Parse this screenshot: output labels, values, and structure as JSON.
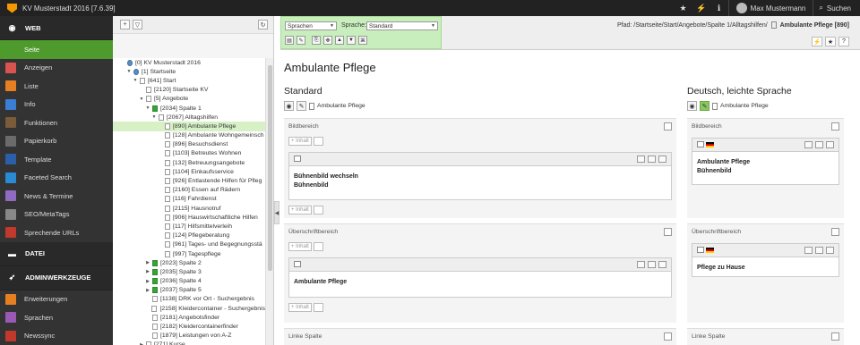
{
  "topbar": {
    "site_name": "KV Musterstadt 2016 [7.6.39]",
    "user_name": "Max Mustermann",
    "search_label": "Suchen"
  },
  "module_menu": {
    "groups": [
      {
        "label": "WEB",
        "icon": "globe-icon",
        "items": [
          {
            "label": "Seite",
            "icon": "page-module-icon",
            "color": "#4f9a2d",
            "active": true
          },
          {
            "label": "Anzeigen",
            "icon": "view-module-icon",
            "color": "#d9534f"
          },
          {
            "label": "Liste",
            "icon": "list-module-icon",
            "color": "#e67e22"
          },
          {
            "label": "Info",
            "icon": "info-module-icon",
            "color": "#3a7fd5"
          },
          {
            "label": "Funktionen",
            "icon": "functions-module-icon",
            "color": "#7a5b3a"
          },
          {
            "label": "Papierkorb",
            "icon": "recycler-module-icon",
            "color": "#6b6b6b"
          },
          {
            "label": "Template",
            "icon": "template-module-icon",
            "color": "#2b5fa8"
          },
          {
            "label": "Faceted Search",
            "icon": "faceted-search-module-icon",
            "color": "#2a8ad4"
          },
          {
            "label": "News & Termine",
            "icon": "news-module-icon",
            "color": "#8f6bc2"
          },
          {
            "label": "SEO/MetaTags",
            "icon": "seo-module-icon",
            "color": "#888888"
          },
          {
            "label": "Sprechende URLs",
            "icon": "realurl-module-icon",
            "color": "#c0392b"
          }
        ]
      },
      {
        "label": "DATEI",
        "icon": "folder-icon",
        "items": []
      },
      {
        "label": "ADMINWERKZEUGE",
        "icon": "rocket-icon",
        "items": [
          {
            "label": "Erweiterungen",
            "icon": "extensions-module-icon",
            "color": "#e67e22"
          },
          {
            "label": "Sprachen",
            "icon": "languages-module-icon",
            "color": "#9b59b6"
          },
          {
            "label": "Newssync",
            "icon": "newssync-module-icon",
            "color": "#c0392b"
          }
        ]
      }
    ]
  },
  "page_tree": {
    "nodes": [
      {
        "label": "[0] KV Musterstadt 2016",
        "depth": 0,
        "toggle": "",
        "kind": "root"
      },
      {
        "label": "[1] Startseite",
        "depth": 1,
        "toggle": "▼",
        "kind": "globe"
      },
      {
        "label": "[641] Start",
        "depth": 2,
        "toggle": "▼",
        "kind": "page"
      },
      {
        "label": "[2120] Startseite KV",
        "depth": 3,
        "toggle": "",
        "kind": "page"
      },
      {
        "label": "[5] Angebote",
        "depth": 3,
        "toggle": "▼",
        "kind": "page"
      },
      {
        "label": "[2034] Spalte 1",
        "depth": 4,
        "toggle": "▼",
        "kind": "green"
      },
      {
        "label": "[2067] Alltagshilfen",
        "depth": 5,
        "toggle": "▼",
        "kind": "page"
      },
      {
        "label": "[890] Ambulante Pflege",
        "depth": 6,
        "toggle": "",
        "kind": "page",
        "selected": true
      },
      {
        "label": "[128] Ambulante Wohngemeinsch",
        "depth": 6,
        "toggle": "",
        "kind": "page"
      },
      {
        "label": "[896] Besuchsdienst",
        "depth": 6,
        "toggle": "",
        "kind": "page"
      },
      {
        "label": "[1103] Betreutes Wohnen",
        "depth": 6,
        "toggle": "",
        "kind": "page"
      },
      {
        "label": "[132] Betreuungsangebote",
        "depth": 6,
        "toggle": "",
        "kind": "page"
      },
      {
        "label": "[1104] Einkaufsservice",
        "depth": 6,
        "toggle": "",
        "kind": "page"
      },
      {
        "label": "[926] Entlastende Hilfen für Pfleg",
        "depth": 6,
        "toggle": "",
        "kind": "page"
      },
      {
        "label": "[2160] Essen auf Rädern",
        "depth": 6,
        "toggle": "",
        "kind": "page"
      },
      {
        "label": "[116] Fahrdienst",
        "depth": 6,
        "toggle": "",
        "kind": "page"
      },
      {
        "label": "[2115] Hausnotruf",
        "depth": 6,
        "toggle": "",
        "kind": "page"
      },
      {
        "label": "[906] Hauswirtschaftliche Hilfen",
        "depth": 6,
        "toggle": "",
        "kind": "page"
      },
      {
        "label": "[117] Hilfsmittelverleih",
        "depth": 6,
        "toggle": "",
        "kind": "page"
      },
      {
        "label": "[124] Pflegeberatung",
        "depth": 6,
        "toggle": "",
        "kind": "page"
      },
      {
        "label": "[961] Tages- und Begegnungsstä",
        "depth": 6,
        "toggle": "",
        "kind": "page"
      },
      {
        "label": "[997] Tagespflege",
        "depth": 6,
        "toggle": "",
        "kind": "page"
      },
      {
        "label": "[2023] Spalte 2",
        "depth": 4,
        "toggle": "▶",
        "kind": "green"
      },
      {
        "label": "[2035] Spalte 3",
        "depth": 4,
        "toggle": "▶",
        "kind": "green"
      },
      {
        "label": "[2036] Spalte 4",
        "depth": 4,
        "toggle": "▶",
        "kind": "green"
      },
      {
        "label": "[2037] Spalte 5",
        "depth": 4,
        "toggle": "▶",
        "kind": "green"
      },
      {
        "label": "[1138] DRK vor Ort - Suchergebnis",
        "depth": 4,
        "toggle": "",
        "kind": "page"
      },
      {
        "label": "[2158] Kleidercontainer - Suchergebnis",
        "depth": 4,
        "toggle": "",
        "kind": "page"
      },
      {
        "label": "[2181] Angebotsfinder",
        "depth": 4,
        "toggle": "",
        "kind": "page"
      },
      {
        "label": "[2182] Kleidercontainerfinder",
        "depth": 4,
        "toggle": "",
        "kind": "page"
      },
      {
        "label": "[1879] Leistungen von A-Z",
        "depth": 4,
        "toggle": "",
        "kind": "page"
      },
      {
        "label": "[271] Kurse",
        "depth": 3,
        "toggle": "▶",
        "kind": "page"
      }
    ]
  },
  "docheader": {
    "view_select": "Sprachen",
    "language_label": "Sprache:",
    "language_select": "Standard",
    "path_prefix": "Pfad: /Startseite/Start/Angebote/Spalte 1/Alltagshilfen/",
    "path_page": "Ambulante Pflege [890]"
  },
  "content": {
    "page_title": "Ambulante Pflege",
    "columns": [
      {
        "title": "Standard",
        "page_label": "Ambulante Pflege",
        "positions": [
          {
            "label": "Bildbereich",
            "elements": [
              "Bühnenbild wechseln",
              "Bühnenbild"
            ]
          },
          {
            "label": "Überschriftbereich",
            "elements": [
              "Ambulante Pflege"
            ]
          },
          {
            "label": "Linke Spalte",
            "elements": []
          }
        ]
      },
      {
        "title": "Deutsch, leichte Sprache",
        "page_label": "Ambulante Pflege",
        "positions": [
          {
            "label": "Bildbereich",
            "elements": [
              "Ambulante Pflege",
              "Bühnenbild"
            ]
          },
          {
            "label": "Überschriftbereich",
            "elements": [
              "Pflege zu Hause"
            ]
          },
          {
            "label": "Linke Spalte",
            "elements": []
          }
        ]
      }
    ],
    "new_content_label": "Inhalt"
  }
}
